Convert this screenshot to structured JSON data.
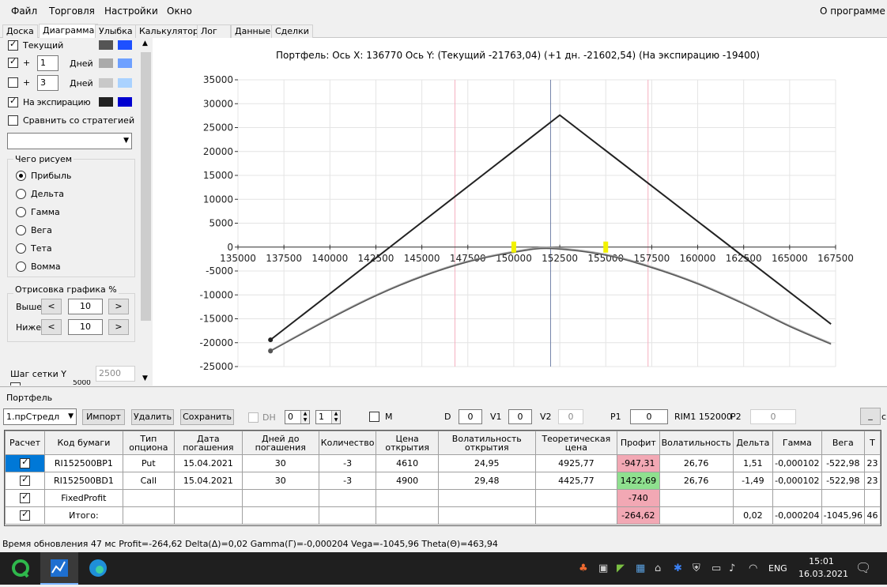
{
  "menu": {
    "file": "Файл",
    "trade": "Торговля",
    "settings": "Настройки",
    "window": "Окно",
    "about": "О программе"
  },
  "tabs": [
    "Доска",
    "Диаграмма",
    "Улыбка",
    "Калькулятор",
    "Лог",
    "Данные",
    "Сделки"
  ],
  "left": {
    "current": "Текущий",
    "plus": "+",
    "plus1_value": "1",
    "plus1_unit": "Дней",
    "plus2_value": "3",
    "plus2_unit": "Дней",
    "expiry": "На экспирацию",
    "compare": "Сравнить со стратегией",
    "what_group": "Чего рисуем",
    "radios": [
      "Прибыль",
      "Дельта",
      "Гамма",
      "Вега",
      "Тета",
      "Вомма"
    ],
    "draw_group": "Отрисовка графика %",
    "above": "Выше",
    "above_value": "10",
    "below": "Ниже",
    "below_value": "10",
    "grid_step": "Шаг сетки Y",
    "grid_step_value": "2500",
    "cut_text": "5000",
    "colors": {
      "current_a": "#555555",
      "current_b": "#1e50ff",
      "plus1_a": "#aaaaaa",
      "plus1_b": "#6ea0ff",
      "plus2_a": "#c8c8c8",
      "plus2_b": "#aad2ff",
      "expiry_a": "#222222",
      "expiry_b": "#0000d0"
    }
  },
  "chart_header": {
    "portfolio": "Портфель:",
    "xaxis": "Ось X:",
    "xval": "136770",
    "yaxis": "Ось Y:",
    "current": "(Текущий -21763,04)",
    "plus1": "(+1 дн. -21602,54)",
    "expiry": "(На экспирацию -19400)"
  },
  "chart_data": {
    "type": "line",
    "xlim": [
      135000,
      167500
    ],
    "ylim": [
      -25000,
      35000
    ],
    "x_ticks": [
      "135000",
      "137500",
      "140000",
      "142500",
      "145000",
      "147500",
      "150000",
      "152500",
      "155000",
      "157500",
      "160000",
      "162500",
      "165000",
      "167500"
    ],
    "y_ticks": [
      "35000",
      "30000",
      "25000",
      "20000",
      "15000",
      "10000",
      "5000",
      "0",
      "-5000",
      "-10000",
      "-15000",
      "-20000",
      "-25000"
    ],
    "series": [
      {
        "color": "#222222",
        "x": [
          136770,
          152500,
          167250
        ],
        "y": [
          -19400,
          27600,
          -16100
        ]
      },
      {
        "color": "#555555",
        "x": [
          136770,
          140000,
          142500,
          145000,
          147500,
          150000,
          152000,
          155000,
          157500,
          160000,
          162500,
          165000,
          167250
        ],
        "y": [
          -21763,
          -15000,
          -10200,
          -6200,
          -3100,
          -1100,
          -300,
          -1700,
          -4300,
          -7700,
          -11900,
          -16600,
          -20300
        ]
      },
      {
        "color": "#aaaaaa",
        "x": [
          136770,
          140000,
          142500,
          145000,
          147500,
          150000,
          152000,
          155000,
          157500,
          160000,
          162500,
          165000,
          167250
        ],
        "y": [
          -21603,
          -14800,
          -10000,
          -6000,
          -2900,
          -900,
          -100,
          -1500,
          -4100,
          -7500,
          -11700,
          -16400,
          -20100
        ]
      }
    ],
    "vlines": [
      {
        "x": 146800,
        "color": "#f5b0c0"
      },
      {
        "x": 152000,
        "color": "#7080a8"
      },
      {
        "x": 157300,
        "color": "#f5b0c0"
      }
    ],
    "markers": [
      {
        "x": 150000,
        "y": 0,
        "color": "#f2f200"
      },
      {
        "x": 155000,
        "y": 0,
        "color": "#f2f200"
      }
    ]
  },
  "portfolio": {
    "label": "Портфель",
    "select": "1.прСтредл",
    "import": "Импорт",
    "delete": "Удалить",
    "save": "Сохранить",
    "dh": "DH",
    "dh_val1": "0",
    "dh_val2": "1",
    "m": "M",
    "d": "D",
    "d_val": "0",
    "v1": "V1",
    "v1_val": "0",
    "v2": "V2",
    "v2_val": "0",
    "p1": "P1",
    "p1_val": "0",
    "rim": "RIM1 152000",
    "p2": "P2",
    "p2_val": "0",
    "min_btn": "_",
    "cut_c": "c"
  },
  "table": {
    "headers": [
      "Расчет",
      "Код бумаги",
      "Тип опциона",
      "Дата погашения",
      "Дней до погашения",
      "Количество",
      "Цена открытия",
      "Волатильность открытия",
      "Теоретическая цена",
      "Профит",
      "Волатильность",
      "Дельта",
      "Гамма",
      "Вега",
      "Т"
    ],
    "rows": [
      [
        "",
        "RI152500BP1",
        "Put",
        "15.04.2021",
        "30",
        "-3",
        "4610",
        "24,95",
        "4925,77",
        "-947,31",
        "26,76",
        "1,51",
        "-0,000102",
        "-522,98",
        "23"
      ],
      [
        "",
        "RI152500BD1",
        "Call",
        "15.04.2021",
        "30",
        "-3",
        "4900",
        "29,48",
        "4425,77",
        "1422,69",
        "26,76",
        "-1,49",
        "-0,000102",
        "-522,98",
        "23"
      ],
      [
        "",
        "FixedProfit",
        "",
        "",
        "",
        "",
        "",
        "",
        "",
        "-740",
        "",
        "",
        "",
        "",
        ""
      ],
      [
        "",
        "Итого:",
        "",
        "",
        "",
        "",
        "",
        "",
        "",
        "-264,62",
        "",
        "0,02",
        "-0,000204",
        "-1045,96",
        "46"
      ]
    ],
    "profit_colors": [
      "#f2a8b4",
      "#8fe08f",
      "#f2a8b4",
      "#f2a8b4"
    ]
  },
  "status": "Время обновления 47 мс  Profit=-264,62 Delta(Δ)=0,02 Gamma(Γ)=-0,000204 Vega=-1045,96 Theta(Θ)=463,94",
  "taskbar": {
    "lang": "ENG",
    "time": "15:01",
    "date": "16.03.2021"
  }
}
